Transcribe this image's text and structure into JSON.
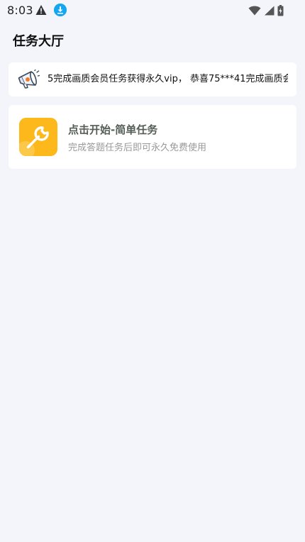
{
  "status_bar": {
    "time": "8:03",
    "icons": [
      "warning-icon",
      "download-icon",
      "wifi-icon",
      "signal-icon",
      "battery-icon"
    ]
  },
  "header": {
    "title": "任务大厅"
  },
  "announcement": {
    "icon": "megaphone-icon",
    "text": "5完成画质会员任务获得永久vip， 恭喜75***41完成画质会"
  },
  "tasks": [
    {
      "icon": "wrench-icon",
      "title": "点击开始-简单任务",
      "subtitle": "完成答题任务后即可永久免费使用"
    }
  ],
  "colors": {
    "background": "#f3f5fa",
    "card": "#ffffff",
    "task_icon_bg": "#fdb81c",
    "download_badge": "#13a7f0",
    "task_title": "#555d58",
    "task_subtitle": "#999999"
  }
}
